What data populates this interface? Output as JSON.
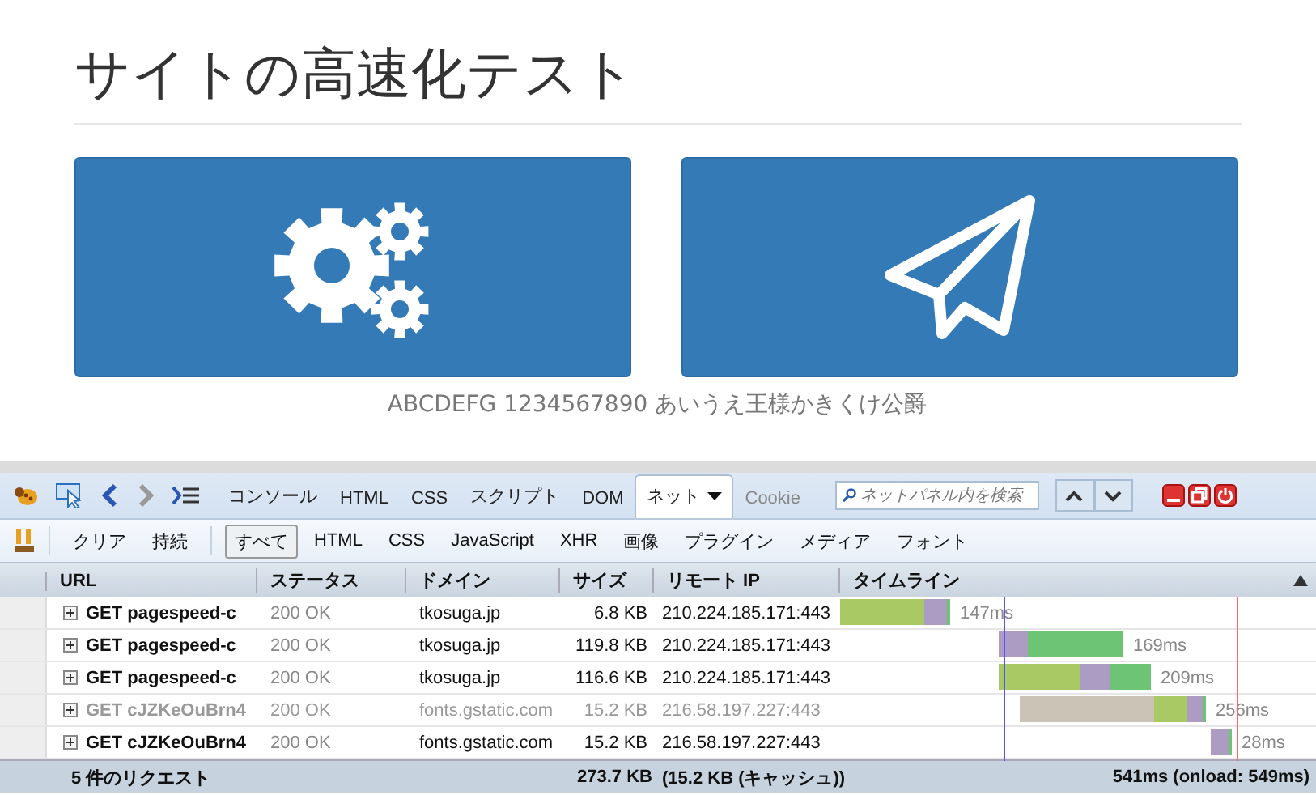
{
  "page": {
    "title": "サイトの高速化テスト",
    "tiles": [
      {
        "kind": "gears"
      },
      {
        "kind": "plane"
      }
    ],
    "caption": "ABCDEFG 1234567890 あいうえ王様かきくけ公爵"
  },
  "devtools": {
    "tabs": [
      {
        "label": "コンソール",
        "selected": false,
        "disabled": false
      },
      {
        "label": "HTML",
        "selected": false,
        "disabled": false
      },
      {
        "label": "CSS",
        "selected": false,
        "disabled": false
      },
      {
        "label": "スクリプト",
        "selected": false,
        "disabled": false
      },
      {
        "label": "DOM",
        "selected": false,
        "disabled": false
      },
      {
        "label": "ネット",
        "selected": true,
        "disabled": false
      },
      {
        "label": "Cookie",
        "selected": false,
        "disabled": true
      }
    ],
    "search": {
      "placeholder": "ネットパネル内を検索"
    },
    "actions": [
      "クリア",
      "持続"
    ],
    "filters": [
      {
        "label": "すべて",
        "selected": true
      },
      {
        "label": "HTML",
        "selected": false
      },
      {
        "label": "CSS",
        "selected": false
      },
      {
        "label": "JavaScript",
        "selected": false
      },
      {
        "label": "XHR",
        "selected": false
      },
      {
        "label": "画像",
        "selected": false
      },
      {
        "label": "プラグイン",
        "selected": false
      },
      {
        "label": "メディア",
        "selected": false
      },
      {
        "label": "フォント",
        "selected": false
      }
    ],
    "columns": [
      "URL",
      "ステータス",
      "ドメイン",
      "サイズ",
      "リモート IP",
      "タイムライン"
    ],
    "rows": [
      {
        "url": "GET pagespeed-c",
        "status": "200 OK",
        "domain": "tkosuga.jp",
        "size": "6.8 KB",
        "ip": "210.224.185.171:443",
        "time": "147ms",
        "cached": false
      },
      {
        "url": "GET pagespeed-c",
        "status": "200 OK",
        "domain": "tkosuga.jp",
        "size": "119.8 KB",
        "ip": "210.224.185.171:443",
        "time": "169ms",
        "cached": false
      },
      {
        "url": "GET pagespeed-c",
        "status": "200 OK",
        "domain": "tkosuga.jp",
        "size": "116.6 KB",
        "ip": "210.224.185.171:443",
        "time": "209ms",
        "cached": false
      },
      {
        "url": "GET cJZKeOuBrn4",
        "status": "200 OK",
        "domain": "fonts.gstatic.com",
        "size": "15.2 KB",
        "ip": "216.58.197.227:443",
        "time": "256ms",
        "cached": true
      },
      {
        "url": "GET cJZKeOuBrn4",
        "status": "200 OK",
        "domain": "fonts.gstatic.com",
        "size": "15.2 KB",
        "ip": "216.58.197.227:443",
        "time": "28ms",
        "cached": false
      }
    ],
    "summary": {
      "count": "5 件のリクエスト",
      "size": "273.7 KB",
      "cache": "(15.2 KB (キャッシュ))",
      "time": "541ms (onload: 549ms)"
    }
  }
}
